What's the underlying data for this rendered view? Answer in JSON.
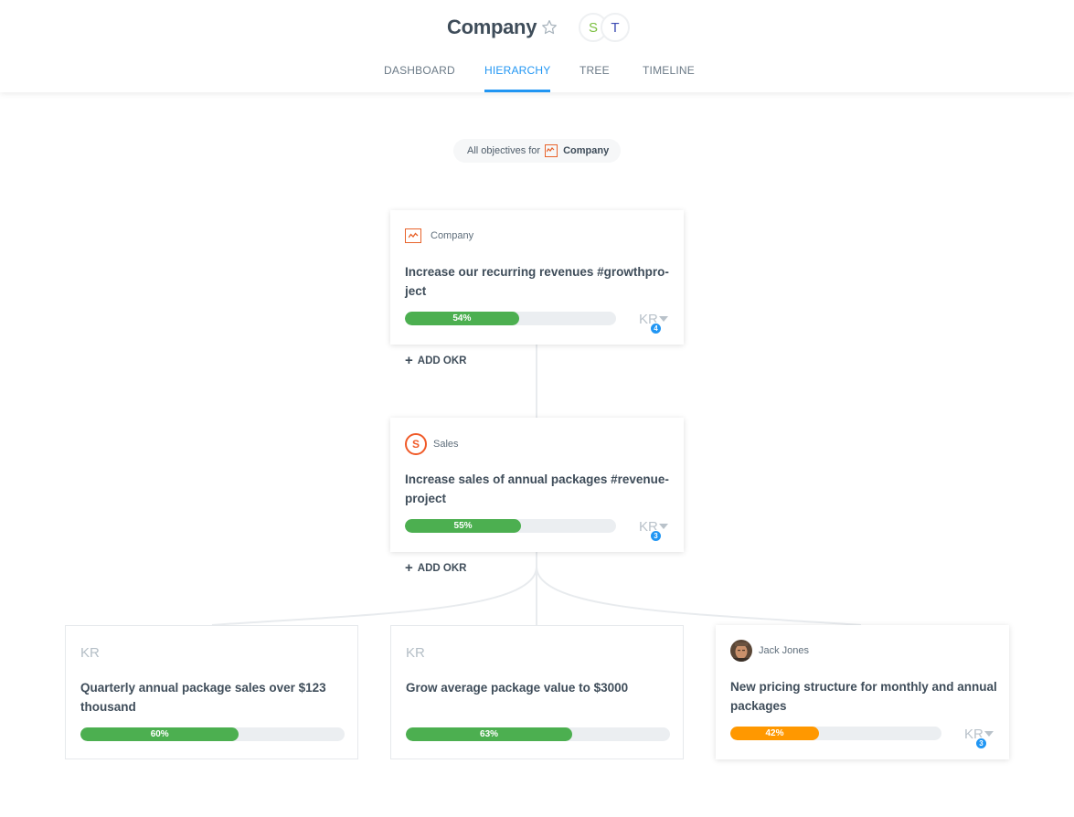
{
  "header": {
    "title": "Company",
    "avatars": [
      {
        "initial": "S",
        "color": "#7bbf3f"
      },
      {
        "initial": "T",
        "color": "#3b4ab3"
      }
    ],
    "tabs": [
      {
        "label": "DASHBOARD",
        "active": false
      },
      {
        "label": "HIERARCHY",
        "active": true
      },
      {
        "label": "TREE",
        "active": false
      },
      {
        "label": "TIMELINE",
        "active": false
      }
    ]
  },
  "scope": {
    "prefix": "All objectives for",
    "name": "Company"
  },
  "objectives": [
    {
      "owner": "Company",
      "owner_icon": "company-chart-icon",
      "title_line1": "Increase our recurring revenues #growthpro-",
      "title_line2": "ject",
      "progress": 54,
      "progress_label": "54%",
      "progress_color": "#4caf50",
      "kr_label": "KR",
      "kr_count": "4",
      "add_label": "ADD OKR"
    },
    {
      "owner": "Sales",
      "owner_icon": "sales-team-icon",
      "owner_initial": "S",
      "title_line1": "Increase sales of annual packages #revenue-",
      "title_line2": "project",
      "progress": 55,
      "progress_label": "55%",
      "progress_color": "#4caf50",
      "kr_label": "KR",
      "kr_count": "3",
      "add_label": "ADD OKR"
    }
  ],
  "key_results": [
    {
      "head": "KR",
      "title_line1": "Quarterly annual package sales over $123",
      "title_line2": "thousand",
      "progress": 60,
      "progress_label": "60%",
      "progress_color": "#4caf50"
    },
    {
      "head": "KR",
      "title_line1": "Grow average package value to $3000",
      "title_line2": "",
      "progress": 63,
      "progress_label": "63%",
      "progress_color": "#4caf50"
    },
    {
      "owner": "Jack Jones",
      "title_line1": "New pricing structure for monthly and annual",
      "title_line2": "packages",
      "progress": 42,
      "progress_label": "42%",
      "progress_color": "#ff9800",
      "kr_label": "KR",
      "kr_count": "3"
    }
  ],
  "colors": {
    "accent": "#2196f3",
    "brand_orange": "#e8632b",
    "success": "#4caf50",
    "warning": "#ff9800"
  }
}
